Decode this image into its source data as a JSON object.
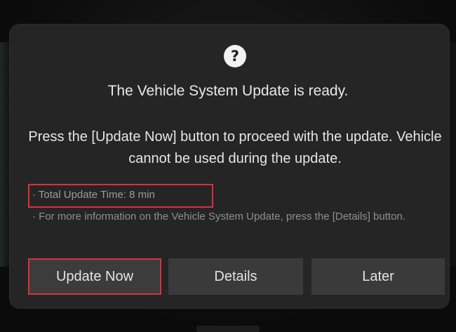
{
  "dialog": {
    "icon": "question-mark-icon",
    "icon_glyph": "?",
    "title": "The Vehicle System Update is ready.",
    "message": "Press the [Update Now] button to proceed with the update. Vehicle cannot be used during the update.",
    "notes": [
      "· Total Update Time: 8 min",
      "· For more information on the Vehicle System Update, press the [Details] button."
    ],
    "buttons": {
      "update_now": "Update Now",
      "details": "Details",
      "later": "Later"
    }
  },
  "colors": {
    "dialog_bg": "#252525",
    "button_bg": "#3a3a3a",
    "highlight": "#d9313b",
    "text_primary": "#e6e6e6",
    "text_secondary": "#9c9c9c"
  }
}
